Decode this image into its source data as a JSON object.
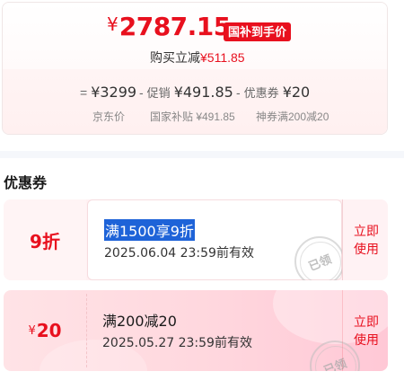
{
  "price": {
    "currency": "¥",
    "final": "2787.15",
    "tag": "国补到手价",
    "save_label": "购买立减",
    "save_amount": "¥511.85"
  },
  "formula": [
    {
      "op": "=",
      "inline_label": "",
      "value": "¥3299",
      "caption": "京东价"
    },
    {
      "op": "-",
      "inline_label": "促销",
      "value": "¥491.85",
      "caption": "国家补贴 ¥491.85"
    },
    {
      "op": "-",
      "inline_label": "优惠券",
      "value": "¥20",
      "caption": "神券满200减20"
    }
  ],
  "section": {
    "title": "优惠券"
  },
  "coupons": [
    {
      "discount_text": "9折",
      "title": "满1500享9折",
      "validity": "2025.06.04 23:59前有效",
      "action": "立即使用",
      "stamp": "已领"
    },
    {
      "discount_currency": "¥",
      "discount_value": "20",
      "title": "满200减20",
      "validity": "2025.05.27 23:59前有效",
      "action": "立即使用",
      "stamp": "已领"
    }
  ],
  "colors": {
    "accent": "#e8101e",
    "selection": "#1e63d8"
  }
}
